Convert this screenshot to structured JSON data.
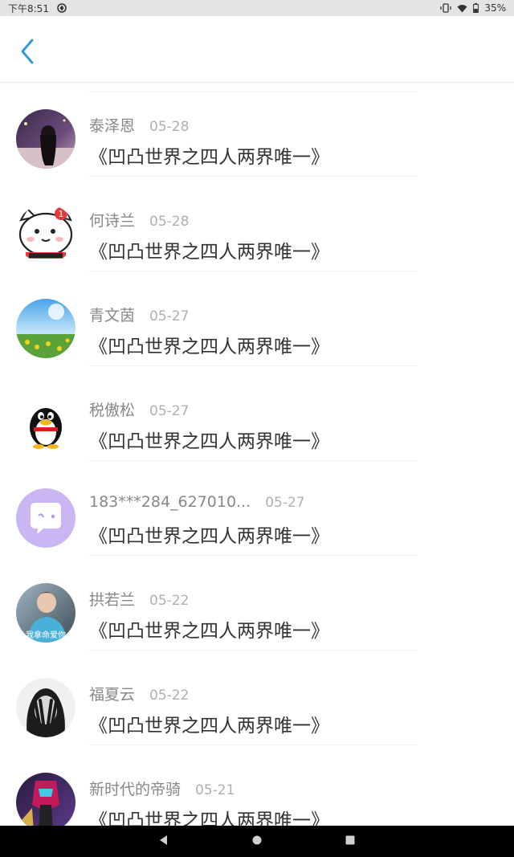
{
  "status_bar": {
    "time": "下午8:51",
    "battery": "35%"
  },
  "header": {
    "back_icon": "chevron-left-icon",
    "accent": "#2d9cdb"
  },
  "items": [
    {
      "name": "泰泽恩",
      "date": "05-28",
      "title": "《凹凸世界之四人两界唯一》"
    },
    {
      "name": "何诗兰",
      "date": "05-28",
      "title": "《凹凸世界之四人两界唯一》"
    },
    {
      "name": "青文茵",
      "date": "05-27",
      "title": "《凹凸世界之四人两界唯一》"
    },
    {
      "name": "税傲松",
      "date": "05-27",
      "title": "《凹凸世界之四人两界唯一》"
    },
    {
      "name": "183***284_627010...",
      "date": "05-27",
      "title": "《凹凸世界之四人两界唯一》"
    },
    {
      "name": "拱若兰",
      "date": "05-22",
      "title": "《凹凸世界之四人两界唯一》"
    },
    {
      "name": "福夏云",
      "date": "05-22",
      "title": "《凹凸世界之四人两界唯一》"
    },
    {
      "name": "新时代的帝骑",
      "date": "05-21",
      "title": "《凹凸世界之四人两界唯一》"
    }
  ],
  "avatar_texts": {
    "cat_badge": "1",
    "photo_caption": "我拿命爱你"
  },
  "nav": {
    "back": "nav-back-icon",
    "home": "nav-home-icon",
    "recents": "nav-recents-icon"
  }
}
